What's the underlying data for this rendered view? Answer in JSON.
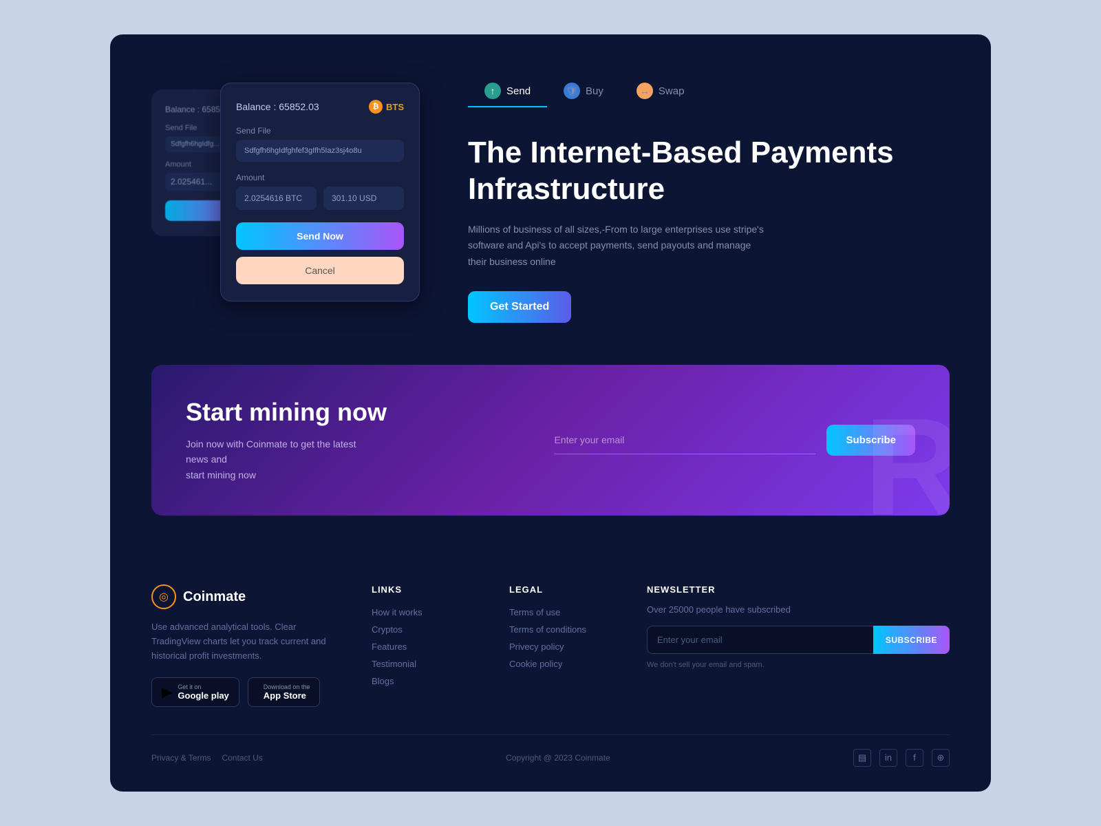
{
  "hero": {
    "wallet": {
      "balance_label": "Balance : ",
      "balance_value": "65852.03",
      "currency": "BTS",
      "send_file_label": "Send File",
      "send_file_value": "Sdfgfh6hgIdfghfef3gIfh5Iaz3sj4o8u",
      "amount_label": "Amount",
      "amount_btc": "2.0254616 BTC",
      "amount_usd": "301.10 USD",
      "btn_send_now": "Send Now",
      "btn_cancel": "Cancel"
    },
    "nav_tabs": [
      {
        "label": "Send",
        "icon_text": "↑",
        "icon_class": "send",
        "active": true
      },
      {
        "label": "Buy",
        "icon_text": "🛡",
        "icon_class": "buy",
        "active": false
      },
      {
        "label": "Swap",
        "icon_text": "↔",
        "icon_class": "swap",
        "active": false
      }
    ],
    "title_line1": "The Internet-Based Payments",
    "title_line2": "Infrastructure",
    "description": "Millions of business of all sizes,-From to large enterprises use stripe's software and Api's to accept payments, send payouts and manage their business online",
    "btn_get_started": "Get Started"
  },
  "mining": {
    "title": "Start mining now",
    "description_line1": "Join now with Coinmate to get the latest news and",
    "description_line2": "start mining now",
    "email_placeholder": "Enter your email",
    "btn_subscribe": "Subscribe",
    "bg_letter": "R"
  },
  "footer": {
    "brand": {
      "name": "Coinmate",
      "description": "Use advanced analytical tools. Clear TradingView charts let you track current and historical profit investments.",
      "google_play_small": "Get it on",
      "google_play_big": "Google play",
      "app_store_small": "Download on the",
      "app_store_big": "App Store"
    },
    "links_title": "LINKS",
    "links": [
      {
        "label": "How it works"
      },
      {
        "label": "Cryptos"
      },
      {
        "label": "Features"
      },
      {
        "label": "Testimonial"
      },
      {
        "label": "Blogs"
      }
    ],
    "legal_title": "LEGAL",
    "legal": [
      {
        "label": "Terms of use"
      },
      {
        "label": "Terms of conditions"
      },
      {
        "label": "Privecy policy"
      },
      {
        "label": "Cookie policy"
      }
    ],
    "newsletter_title": "NEWSLETTER",
    "newsletter_sub_text": "Over 25000 people have subscribed",
    "newsletter_placeholder": "Enter your email",
    "newsletter_btn": "SUBSCRIBE",
    "newsletter_disclaimer": "We don't sell your email and spam.",
    "bottom_privacy": "Privacy & Terms",
    "bottom_contact": "Contact Us",
    "copyright": "Copyright @ 2023 Coinmate",
    "social_icons": [
      "▤",
      "in",
      "f",
      "⊕"
    ]
  }
}
